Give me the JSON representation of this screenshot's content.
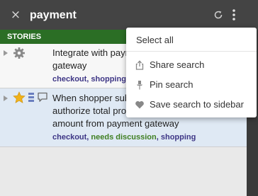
{
  "header": {
    "close_symbol": "×",
    "search_term": "payment",
    "refresh_icon": "refresh-icon",
    "more_icon": "kebab-vertical-icon"
  },
  "panel": {
    "header_label": "STORIES"
  },
  "stories": [
    {
      "title_lines": [
        "Integrate with paym",
        "gateway"
      ],
      "type_icon": "gear-icon",
      "labels": [
        {
          "text": "checkout",
          "color": "#3d3585"
        },
        {
          "text": "shopping",
          "color": "#3d3585"
        }
      ]
    },
    {
      "title_lines": [
        "When shopper sub",
        "authorize total proc",
        "amount from payment gateway"
      ],
      "type_icon": "star-icon",
      "labels": [
        {
          "text": "checkout",
          "color": "#3d3585"
        },
        {
          "text": "needs discussion",
          "color": "#3f7f22"
        },
        {
          "text": "shopping",
          "color": "#3d3585"
        }
      ]
    }
  ],
  "menu": {
    "select_all": "Select all",
    "items": [
      {
        "label": "Share search",
        "icon": "share-icon"
      },
      {
        "label": "Pin search",
        "icon": "pin-icon"
      },
      {
        "label": "Save search to sidebar",
        "icon": "heart-icon"
      }
    ]
  },
  "colors": {
    "stories_header": "#2b6e25",
    "label_purple": "#3d3585",
    "label_green": "#3f7f22",
    "star": "#f0b21a"
  }
}
